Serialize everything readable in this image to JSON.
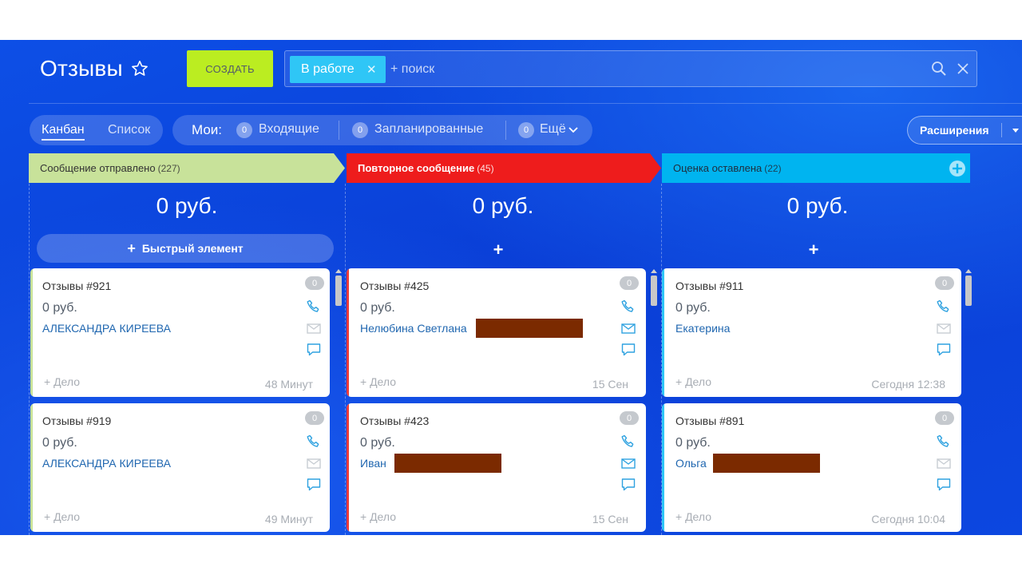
{
  "header": {
    "title": "Отзывы",
    "create_label": "СОЗДАТЬ",
    "filter_chip": "В работе",
    "search_placeholder": "+ поиск"
  },
  "toolbar": {
    "view_kanban": "Канбан",
    "view_list": "Список",
    "my_label": "Мои:",
    "counters": [
      {
        "count": "0",
        "label": "Входящие"
      },
      {
        "count": "0",
        "label": "Запланированные"
      },
      {
        "count": "0",
        "label": "Ещё"
      }
    ],
    "extensions_label": "Расширения"
  },
  "stages": [
    {
      "name": "Сообщение отправлено",
      "count": "(227)",
      "color": "#c8e29a",
      "sum": "0 руб.",
      "quick_label": "Быстрый элемент",
      "cards": [
        {
          "title": "Отзывы #921",
          "sum": "0 руб.",
          "contact": "АЛЕКСАНДРА КИРЕЕВА",
          "task": "+ Дело",
          "time": "48 Минут",
          "badge": "0"
        },
        {
          "title": "Отзывы #919",
          "sum": "0 руб.",
          "contact": "АЛЕКСАНДРА КИРЕЕВА",
          "task": "+ Дело",
          "time": "49 Минут",
          "badge": "0"
        }
      ]
    },
    {
      "name": "Повторное сообщение",
      "count": "(45)",
      "color": "#ee1c1c",
      "sum": "0 руб.",
      "quick_label": "+",
      "cards": [
        {
          "title": "Отзывы #425",
          "sum": "0 руб.",
          "contact": "Нелюбина Светлана",
          "task": "+ Дело",
          "time": "15 Сен",
          "badge": "0"
        },
        {
          "title": "Отзывы #423",
          "sum": "0 руб.",
          "contact": "Иван",
          "task": "+ Дело",
          "time": "15 Сен",
          "badge": "0"
        }
      ]
    },
    {
      "name": "Оценка оставлена",
      "count": "(22)",
      "color": "#00b4f0",
      "sum": "0 руб.",
      "quick_label": "+",
      "cards": [
        {
          "title": "Отзывы #911",
          "sum": "0 руб.",
          "contact": "Екатерина",
          "task": "+ Дело",
          "time": "Сегодня 12:38",
          "badge": "0"
        },
        {
          "title": "Отзывы #891",
          "sum": "0 руб.",
          "contact": "Ольга",
          "task": "+ Дело",
          "time": "Сегодня 10:04",
          "badge": "0"
        }
      ]
    }
  ]
}
